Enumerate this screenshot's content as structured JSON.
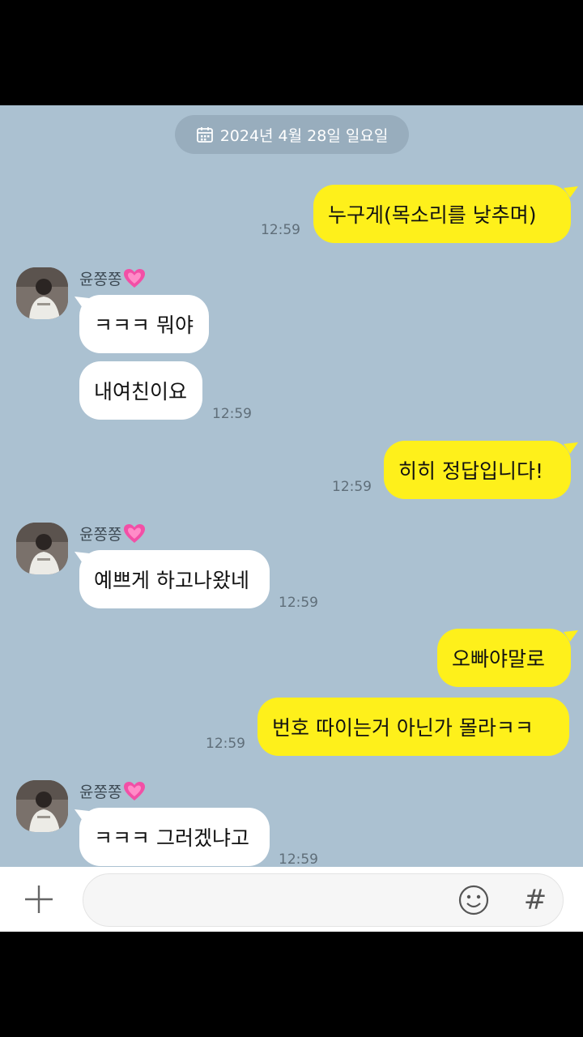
{
  "date_divider": "2024년 4월 28일 일요일",
  "contact": {
    "name": "윤쫑쫑"
  },
  "messages": [
    {
      "text": "누구게(목소리를 낮추며)",
      "time": "12:59"
    },
    {
      "text": "ㅋㅋㅋ 뭐야"
    },
    {
      "text": "내여친이요",
      "time": "12:59"
    },
    {
      "text": "히히 정답입니다!",
      "time": "12:59"
    },
    {
      "text": "예쁘게 하고나왔네",
      "time": "12:59"
    },
    {
      "text": "오빠야말로"
    },
    {
      "text": "번호 따이는거 아닌가 몰라ㅋㅋ",
      "time": "12:59"
    },
    {
      "text": "ㅋㅋㅋ 그러겠냐고",
      "time": "12:59"
    }
  ],
  "input": {
    "placeholder": "",
    "value": ""
  },
  "icons": {
    "plus": "plus-icon",
    "emoji": "emoji-icon",
    "hash": "#"
  },
  "colors": {
    "chat_bg": "#abc1d1",
    "outgoing": "#fef01b",
    "incoming": "#ffffff"
  }
}
